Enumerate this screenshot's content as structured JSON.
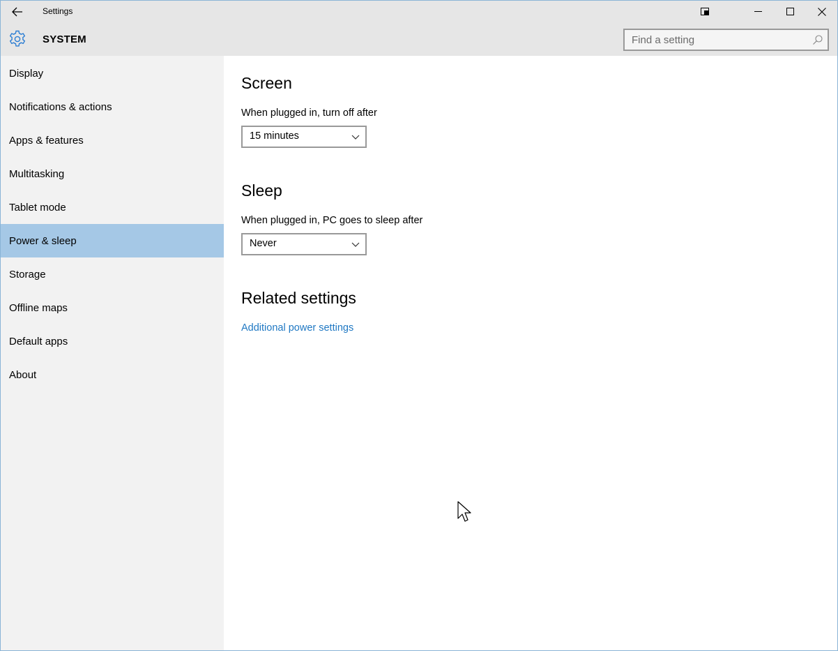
{
  "window": {
    "title": "Settings"
  },
  "header": {
    "section": "SYSTEM",
    "search_placeholder": "Find a setting"
  },
  "sidebar": {
    "items": [
      {
        "label": "Display"
      },
      {
        "label": "Notifications & actions"
      },
      {
        "label": "Apps & features"
      },
      {
        "label": "Multitasking"
      },
      {
        "label": "Tablet mode"
      },
      {
        "label": "Power & sleep",
        "selected": true
      },
      {
        "label": "Storage"
      },
      {
        "label": "Offline maps"
      },
      {
        "label": "Default apps"
      },
      {
        "label": "About"
      }
    ]
  },
  "main": {
    "screen": {
      "heading": "Screen",
      "label": "When plugged in, turn off after",
      "value": "15 minutes"
    },
    "sleep": {
      "heading": "Sleep",
      "label": "When plugged in, PC goes to sleep after",
      "value": "Never"
    },
    "related": {
      "heading": "Related settings",
      "link": "Additional power settings"
    }
  },
  "colors": {
    "selected_nav": "#a5c8e6",
    "link": "#1f78c3",
    "accent": "#2d7ed3"
  },
  "icons": [
    "back-arrow-icon",
    "tablet-mode-icon",
    "minimize-icon",
    "maximize-icon",
    "close-icon",
    "gear-icon",
    "search-icon",
    "chevron-down-icon",
    "mouse-cursor-icon"
  ]
}
